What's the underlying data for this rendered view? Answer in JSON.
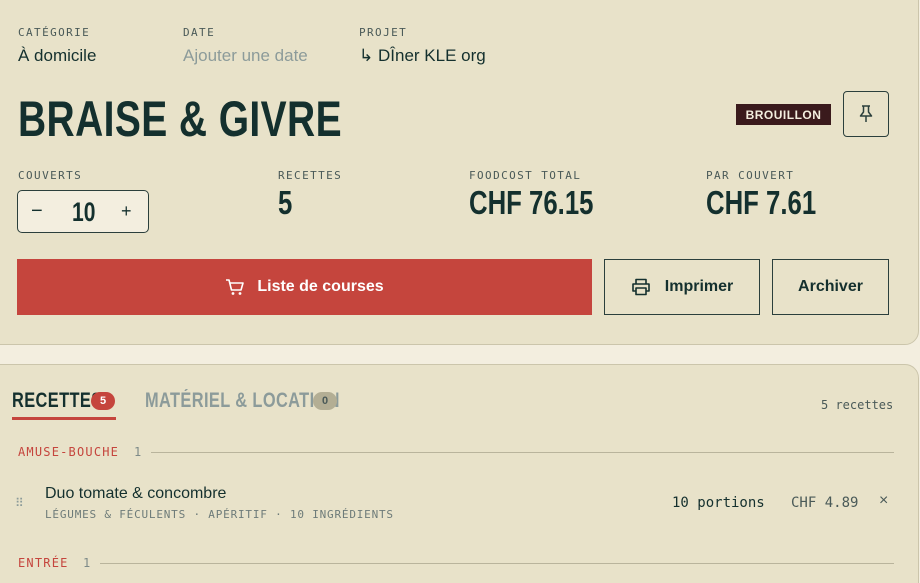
{
  "header": {
    "category_label": "CATÉGORIE",
    "category_value": "À domicile",
    "date_label": "DATE",
    "date_placeholder": "Ajouter une date",
    "project_label": "PROJET",
    "project_prefix": "↳",
    "project_value": "DÎner KLE org",
    "title": "BRAISE & GIVRE",
    "status_badge": "BROUILLON",
    "pin_icon": "pin-icon"
  },
  "stats": {
    "covers_label": "COUVERTS",
    "covers_value": "10",
    "minus": "−",
    "plus": "+",
    "recipes_label": "RECETTES",
    "recipes_value": "5",
    "foodcost_label": "FOODCOST TOTAL",
    "foodcost_value": "CHF 76.15",
    "per_cover_label": "PAR COUVERT",
    "per_cover_value": "CHF 7.61"
  },
  "actions": {
    "shopping_list": "Liste de courses",
    "print": "Imprimer",
    "archive": "Archiver"
  },
  "tabs": {
    "recipes_label": "RECETTES",
    "recipes_count": "5",
    "equipment_label": "MATÉRIEL & LOCATION",
    "equipment_count": "0",
    "recipes_total": "5 recettes"
  },
  "sections": [
    {
      "label": "AMUSE-BOUCHE",
      "count": "1",
      "items": [
        {
          "name": "Duo tomate & concombre",
          "meta": "LÉGUMES & FÉCULENTS · APÉRITIF · 10 INGRÉDIENTS",
          "portions": "10 portions",
          "cost": "CHF 4.89",
          "remove": "×"
        }
      ]
    },
    {
      "label": "ENTRÉE",
      "count": "1"
    }
  ],
  "colors": {
    "accent": "#c5453d",
    "ink": "#14302e",
    "panel": "#e8e2c9",
    "background": "#f3eedf",
    "badge": "#3a1a1c"
  }
}
